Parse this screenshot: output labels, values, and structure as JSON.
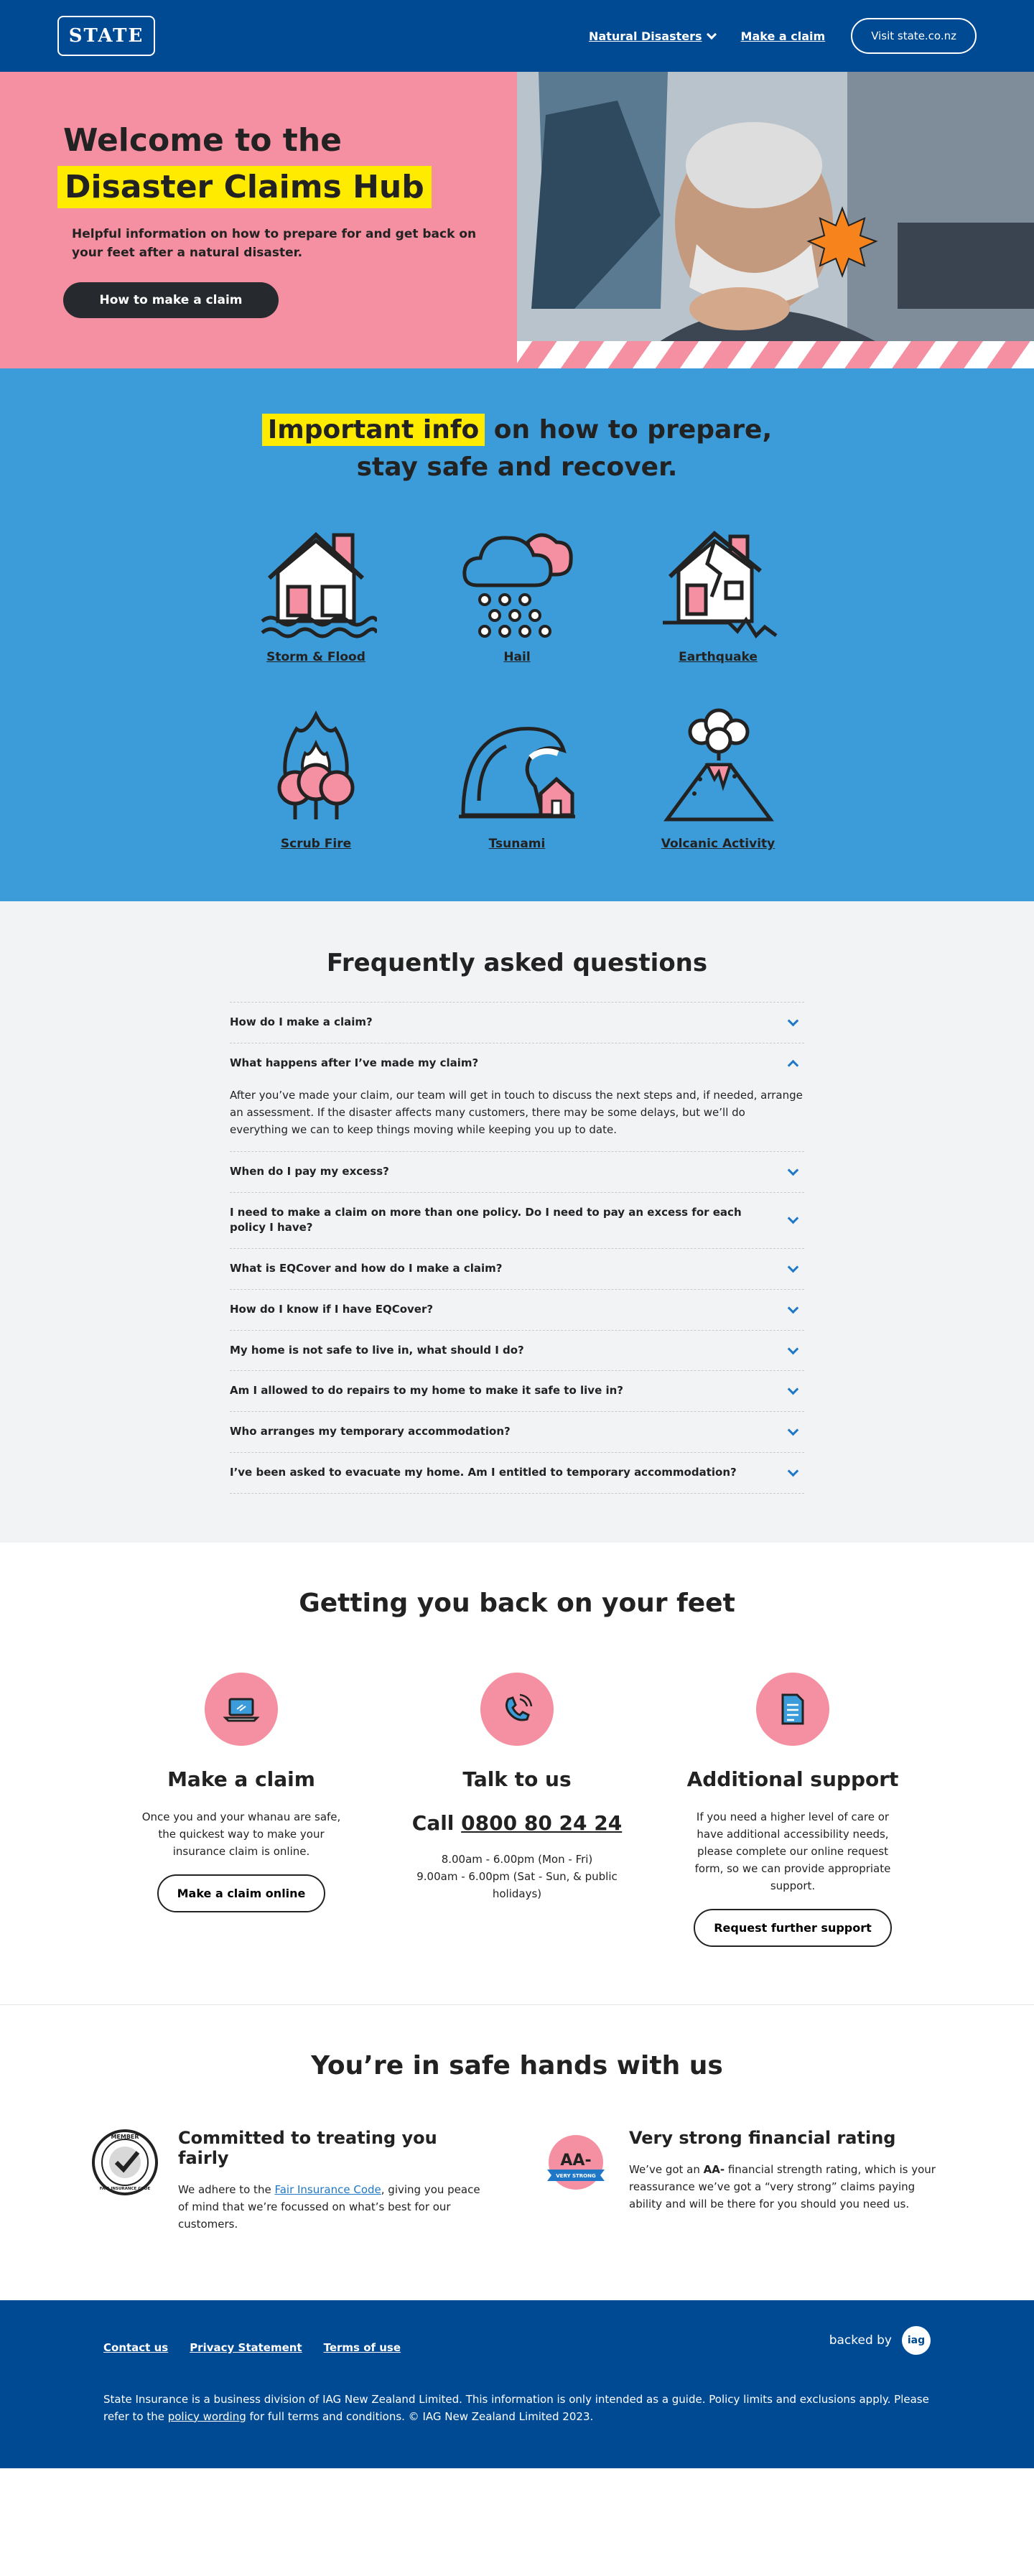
{
  "header": {
    "logo": "STATE",
    "nav_natural": "Natural Disasters",
    "nav_claim": "Make a claim",
    "visit": "Visit state.co.nz"
  },
  "hero": {
    "title_line1": "Welcome to the",
    "title_line2": "Disaster Claims Hub",
    "subtitle": "Helpful information on how to prepare for and get back on your feet after a natural disaster.",
    "cta": "How to make a claim"
  },
  "info": {
    "title_highlight": "Important info",
    "title_rest1": " on how to prepare,",
    "title_rest2": "stay safe and recover.",
    "hazards": [
      {
        "label": "Storm & Flood",
        "icon": "house-flood-icon"
      },
      {
        "label": "Hail",
        "icon": "hail-cloud-icon"
      },
      {
        "label": "Earthquake",
        "icon": "cracked-house-icon"
      },
      {
        "label": "Scrub Fire",
        "icon": "tree-fire-icon"
      },
      {
        "label": "Tsunami",
        "icon": "wave-house-icon"
      },
      {
        "label": "Volcanic Activity",
        "icon": "volcano-icon"
      }
    ]
  },
  "faq": {
    "title": "Frequently asked questions",
    "items": [
      {
        "q": "How do I make a claim?"
      },
      {
        "q": "What happens after I’ve made my claim?",
        "a": "After you’ve made your claim, our team will get in touch to discuss the next steps and, if needed, arrange an assessment. If the disaster affects many customers, there may be some delays, but we’ll do everything we can to keep things moving while keeping you up to date."
      },
      {
        "q": "When do I pay my excess?"
      },
      {
        "q": "I need to make a claim on more than one policy. Do I need to pay an excess for each policy I have?"
      },
      {
        "q": "What is EQCover and how do I make a claim?"
      },
      {
        "q": "How do I know if I have EQCover?"
      },
      {
        "q": "My home is not safe to live in, what should I do?"
      },
      {
        "q": "Am I allowed to do repairs to my home to make it safe to live in?"
      },
      {
        "q": "Who arranges my temporary accommodation?"
      },
      {
        "q": "I’ve been asked to evacuate my home. Am I entitled to temporary accommodation?"
      }
    ]
  },
  "feet": {
    "title": "Getting you back on your feet",
    "claim": {
      "title": "Make a claim",
      "text": "Once you and your whanau are safe, the quickest way to make your insurance claim is online.",
      "button": "Make a claim online"
    },
    "talk": {
      "title": "Talk to us",
      "call": "Call ",
      "phone": "0800 80 24 24",
      "hours1": "8.00am - 6.00pm (Mon - Fri)",
      "hours2": "9.00am - 6.00pm (Sat - Sun, & public holidays)"
    },
    "support": {
      "title": "Additional support",
      "text": "If you need a higher level of care or have additional accessibility needs, please complete our online request form, so we can provide appropriate support.",
      "button": "Request further support"
    }
  },
  "safe": {
    "title": "You’re in safe hands with us",
    "fair": {
      "title": "Committed to treating you fairly",
      "text_pre": "We adhere to the ",
      "link": "Fair Insurance Code",
      "text_post": ", giving you peace of mind that we’re focussed on what’s best for our customers.",
      "badge_top": "MEMBER",
      "badge_bottom": "FAIR INSURANCE CODE"
    },
    "rating": {
      "title": "Very strong financial rating",
      "text_pre": "We’ve got an ",
      "bold": "AA-",
      "text_post": " financial strength rating, which is your reassurance we’ve got a “very strong” claims paying ability and will be there for you should you need us.",
      "badge_grade": "AA-",
      "badge_label": "VERY STRONG"
    }
  },
  "footer": {
    "links": [
      "Contact us",
      "Privacy Statement",
      "Terms of use"
    ],
    "backed_by": "backed by",
    "iag": "iag",
    "text_pre": "State Insurance is a business division of IAG New Zealand Limited. This information is only intended as a guide. Policy limits and exclusions apply. Please refer to the ",
    "text_link": "policy wording",
    "text_post": " for full terms and conditions. © IAG New Zealand Limited 2023."
  },
  "colors": {
    "navy": "#004a94",
    "pink": "#f590a2",
    "yellow": "#ffeb00",
    "blue": "#3c9cda"
  }
}
